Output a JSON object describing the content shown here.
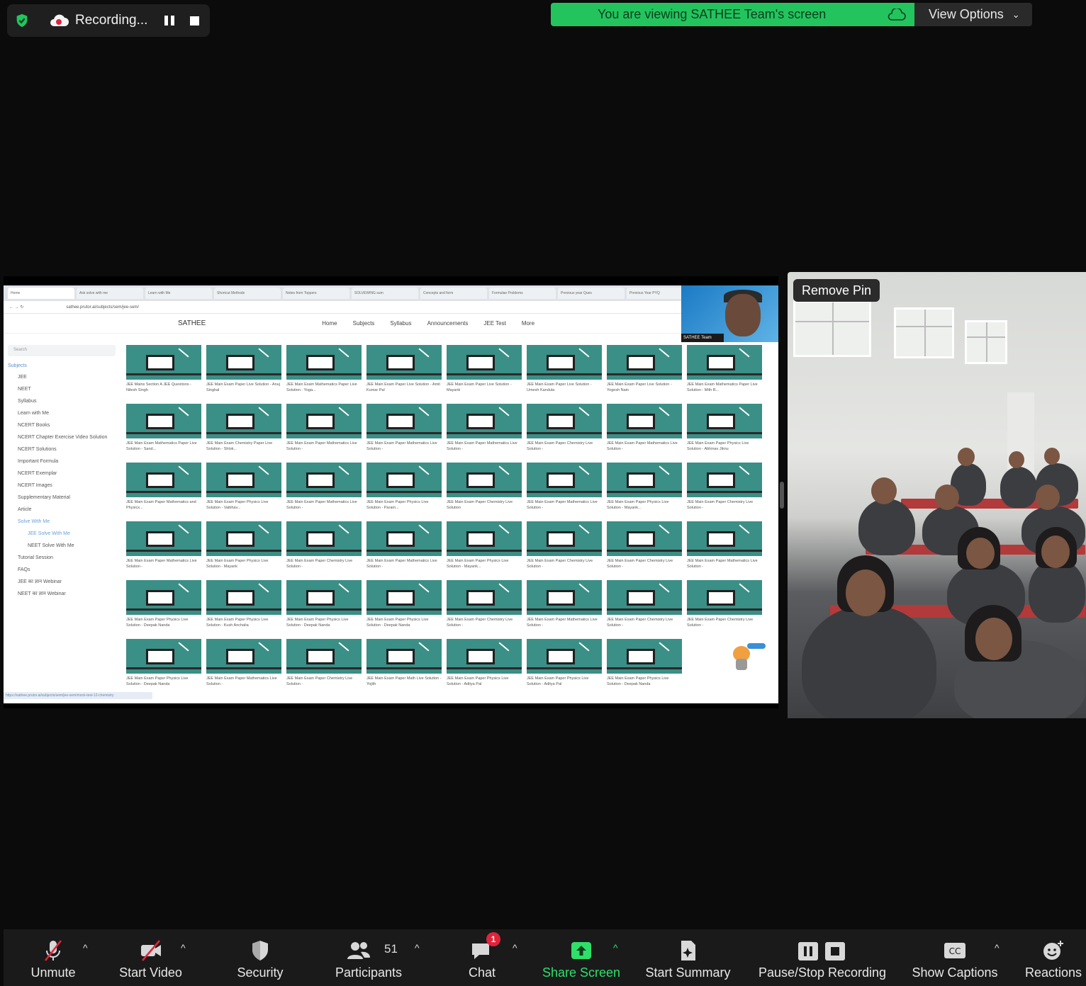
{
  "recording": {
    "status_text": "Recording..."
  },
  "banner": {
    "viewing_text": "You are viewing SATHEE Team's screen",
    "view_options_label": "View Options"
  },
  "shared_screen": {
    "tabs": [
      "Home",
      "Ask solve with me",
      "Learn with Me",
      "Shortcut Methods",
      "Notes from Toppers",
      "SOLVEWING sum",
      "Concepts and form",
      "Formulae Problems",
      "Previous year Ques",
      "Previous Year PYQ"
    ],
    "address": "sathee.prutor.ai/subjects/sem/jee-sem/",
    "site_title": "SATHEE",
    "nav_links": [
      "Home",
      "Subjects",
      "Syllabus",
      "Announcements",
      "JEE Test",
      "More"
    ],
    "sidebar": {
      "search_placeholder": "Search",
      "heading": "Subjects",
      "items": [
        "JEE",
        "NEET",
        "Syllabus",
        "Learn with Me",
        "NCERT Books",
        "NCERT Chapter Exercise Video Solution",
        "NCERT Solutions",
        "Important Formula",
        "NCERT Exemplar",
        "NCERT Images",
        "Supplementary Material",
        "Article",
        "Solve With Me",
        "JEE Solve With Me",
        "NEET Solve With Me",
        "Tutorial Session",
        "FAQs",
        "JEE का ज्ञान Webinar",
        "NEET का ज्ञान Webinar"
      ]
    },
    "cards": [
      "JEE Mains Section A JEE Questions - Nilesh Singh",
      "JEE Main Exam Paper Live Solution - Anuj Singhal",
      "JEE Main Exam Mathematics Paper Live Solution - Yoga...",
      "JEE Main Exam Paper Live Solution - Amit Kumar Pal",
      "JEE Main Exam Paper Live Solution - Mayank",
      "JEE Main Exam Paper Live Solution - Umesh Kandula",
      "JEE Main Exam Paper Live Solution - Yogesh Nain",
      "JEE Main Exam Mathematics Paper Live Solution - Mith R...",
      "JEE Main Exam Mathematics Paper Live Solution - Sand...",
      "JEE Main Exam Chemistry Paper Live Solution - Shlok...",
      "JEE Main Exam Paper Mathematics Live Solution -",
      "JEE Main Exam Paper Mathematics Live Solution -",
      "JEE Main Exam Paper Mathematics Live Solution -",
      "JEE Main Exam Paper Chemistry Live Solution -",
      "JEE Main Exam Paper Mathematics Live Solution -",
      "JEE Main Exam Paper Physics Live Solution - Abhinav Jiknu",
      "JEE Main Exam Paper Mathematics and Physics...",
      "JEE Main Exam Paper Physics Live Solution - Vaibhav...",
      "JEE Main Exam Paper Mathematics Live Solution -",
      "JEE Main Exam Paper Physics Live Solution - Param...",
      "JEE Main Exam Paper Chemistry Live Solution",
      "JEE Main Exam Paper Mathematics Live Solution -",
      "JEE Main Exam Paper Physics Live Solution - Mayank...",
      "JEE Main Exam Paper Chemistry Live Solution -",
      "JEE Main Exam Paper Mathematics Live Solution -",
      "JEE Main Exam Paper Physics Live Solution - Mayank",
      "JEE Main Exam Paper Chemistry Live Solution -",
      "JEE Main Exam Paper Mathematics Live Solution -",
      "JEE Main Exam Paper Physics Live Solution - Mayank...",
      "JEE Main Exam Paper Chemistry Live Solution -",
      "JEE Main Exam Paper Chemistry Live Solution -",
      "JEE Main Exam Paper Mathematics Live Solution -",
      "JEE Main Exam Paper Physics Live Solution - Deepak Nanda",
      "JEE Main Exam Paper Physics Live Solution - Kush Anchalia",
      "JEE Main Exam Paper Physics Live Solution - Deepak Nanda",
      "JEE Main Exam Paper Physics Live Solution - Deepak Nanda",
      "JEE Main Exam Paper Chemistry Live Solution -",
      "JEE Main Exam Paper Mathematics Live Solution -",
      "JEE Main Exam Paper Chemistry Live Solution -",
      "JEE Main Exam Paper Chemistry Live Solution -",
      "JEE Main Exam Paper Physics Live Solution - Deepak Nanda",
      "JEE Main Exam Paper Mathematics Live Solution -",
      "JEE Main Exam Paper Chemistry Live Solution -",
      "JEE Main Exam Paper Math Live Solution - Yojith",
      "JEE Main Exam Paper Physics Live Solution - Aditya Pal",
      "JEE Main Exam Paper Physics Live Solution - Aditya Pal",
      "JEE Main Exam Paper Physics Live Solution - Deepak Nanda"
    ],
    "presenter_name": "SATHEE Team",
    "status_url": "https://sathee.prutor.ai/subjects/sem/jee-sem/mock-test-12-chemistry"
  },
  "video": {
    "remove_pin_label": "Remove Pin"
  },
  "toolbar": {
    "unmute": "Unmute",
    "start_video": "Start Video",
    "security": "Security",
    "participants": "Participants",
    "participants_count": "51",
    "chat": "Chat",
    "chat_badge": "1",
    "share_screen": "Share Screen",
    "start_summary": "Start Summary",
    "pause_stop_recording": "Pause/Stop Recording",
    "show_captions": "Show Captions",
    "reactions": "Reactions"
  },
  "colors": {
    "share_green": "#2ee06a",
    "banner_green": "#23c45e",
    "record_red": "#e0243b"
  }
}
